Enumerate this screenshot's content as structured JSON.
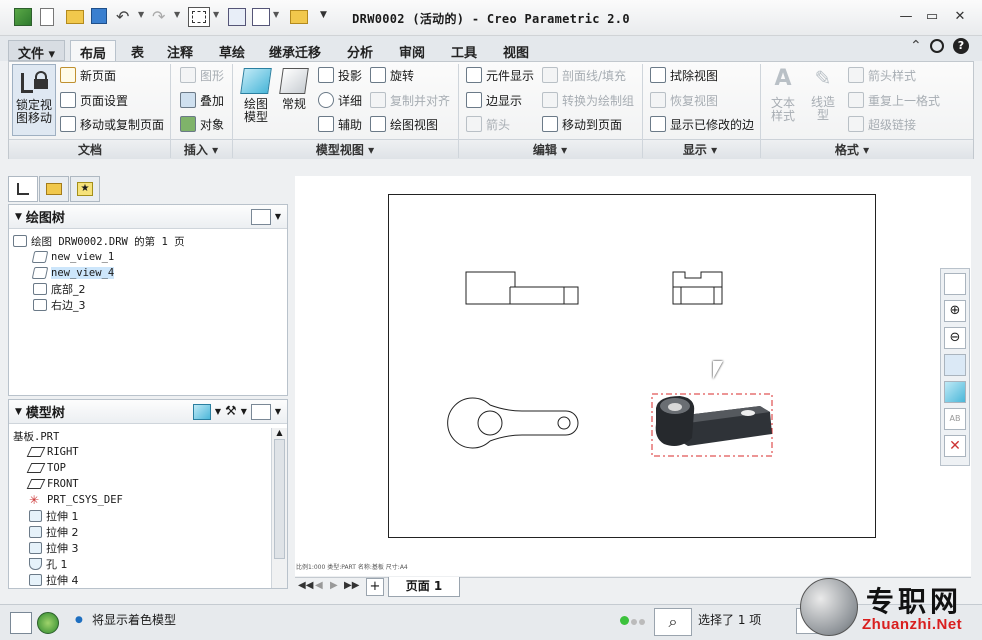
{
  "window": {
    "title": "DRW0002 (活动的) - Creo Parametric 2.0",
    "controls": [
      "—",
      "▭",
      "✕"
    ]
  },
  "tabs": [
    {
      "label": "文件 ▾"
    },
    {
      "label": "布局"
    },
    {
      "label": "表"
    },
    {
      "label": "注释"
    },
    {
      "label": "草绘"
    },
    {
      "label": "继承迁移"
    },
    {
      "label": "分析"
    },
    {
      "label": "审阅"
    },
    {
      "label": "工具"
    },
    {
      "label": "视图"
    }
  ],
  "ribbon": {
    "doc": {
      "lock_line1": "锁定视",
      "lock_line2": "图移动",
      "new_page": "新页面",
      "page_setup": "页面设置",
      "move_copy": "移动或复制页面",
      "group": "文档"
    },
    "insert": {
      "graphics": "图形",
      "overlay": "叠加",
      "object": "对象",
      "group": "插入 ▾"
    },
    "model_views": {
      "drawing_model_1": "绘图",
      "drawing_model_2": "模型",
      "general": "常规",
      "projection": "投影",
      "detailed": "详细",
      "auxiliary": "辅助",
      "revolved": "旋转",
      "copy_align": "复制并对齐",
      "drawing_view": "绘图视图",
      "group": "模型视图 ▾"
    },
    "edit": {
      "component_display": "元件显示",
      "edge_display": "边显示",
      "arrow": "箭头",
      "section_fill": "剖面线/填充",
      "convert": "转换为绘制组",
      "move_to_page": "移动到页面",
      "group": "编辑 ▾"
    },
    "display": {
      "erase_view": "拭除视图",
      "restore_view": "恢复视图",
      "show_modified_edges": "显示已修改的边",
      "group": "显示 ▾"
    },
    "format": {
      "text_style_1": "文本",
      "text_style_2": "样式",
      "line_style_1": "线造",
      "line_style_2": "型",
      "arrow_style": "箭头样式",
      "repeat_format": "重复上一格式",
      "hyperlink": "超级链接",
      "group": "格式 ▾"
    }
  },
  "drawing_tree": {
    "title": "绘图树",
    "items": [
      {
        "label": "绘图 DRW0002.DRW 的第 1 页"
      },
      {
        "label": "new_view_1"
      },
      {
        "label": "new_view_4"
      },
      {
        "label": "底部_2"
      },
      {
        "label": "右边_3"
      }
    ]
  },
  "model_tree": {
    "title": "模型树",
    "items": [
      {
        "label": "基板.PRT"
      },
      {
        "label": "RIGHT"
      },
      {
        "label": "TOP"
      },
      {
        "label": "FRONT"
      },
      {
        "label": "PRT_CSYS_DEF"
      },
      {
        "label": "拉伸 1"
      },
      {
        "label": "拉伸 2"
      },
      {
        "label": "拉伸 3"
      },
      {
        "label": "孔 1"
      },
      {
        "label": "拉伸 4"
      }
    ]
  },
  "sheet_footer": "比例1:000  类型:PART  名称:基板  尺寸:A4",
  "page_bar": {
    "add": "+",
    "page_tab": "页面 1"
  },
  "status": {
    "message": "将显示着色模型",
    "selection": "选择了 1 项"
  },
  "watermark": {
    "cn": "专职网",
    "url": "Zhuanzhi.Net"
  },
  "colors": {
    "accent": "#1e6fc0",
    "selection_red": "#d92b2b",
    "shaded_model": "#2b2f33"
  }
}
